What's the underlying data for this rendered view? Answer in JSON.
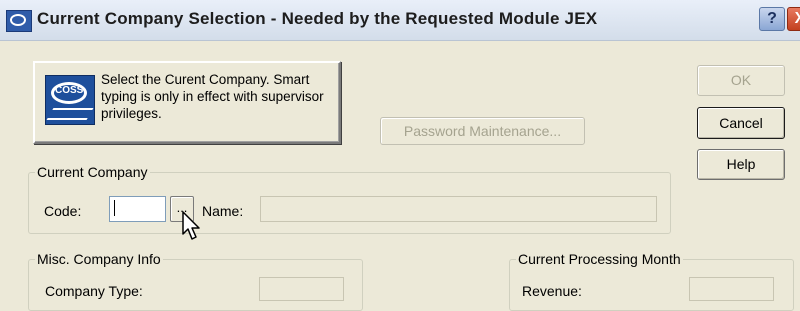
{
  "window": {
    "title": "Current Company Selection - Needed by the Requested Module JEX",
    "help_glyph": "?",
    "close_glyph": "X"
  },
  "banner": {
    "text": "Select the Curent Company. Smart typing is only in effect with supervisor privileges.",
    "logo_text": "COSS",
    "logo_icon": "company-logo-icon"
  },
  "buttons": {
    "password_maintenance": "Password Maintenance...",
    "ok": "OK",
    "cancel": "Cancel",
    "help": "Help"
  },
  "current_company": {
    "legend": "Current Company",
    "code_label": "Code:",
    "code_value": "",
    "lookup_label": "...",
    "name_label": "Name:",
    "name_value": ""
  },
  "misc_info": {
    "legend": "Misc. Company Info",
    "company_type_label": "Company Type:"
  },
  "processing_month": {
    "legend": "Current Processing Month",
    "revenue_label": "Revenue:"
  },
  "colors": {
    "dialog_bg": "#ece9d8",
    "titlebar_bg": "#dde5f0",
    "close_button": "#c3401f"
  }
}
